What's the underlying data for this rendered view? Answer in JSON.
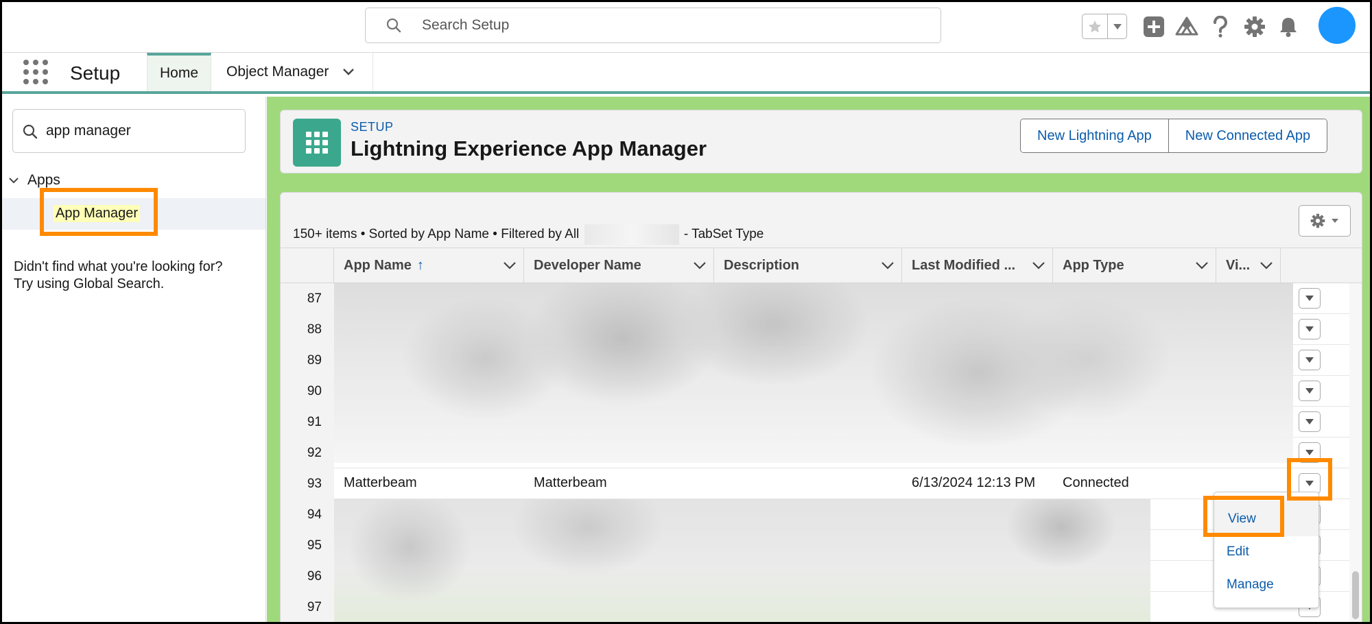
{
  "header": {
    "search_placeholder": "Search Setup"
  },
  "context": {
    "app_name": "Setup",
    "tabs": [
      {
        "label": "Home"
      },
      {
        "label": "Object Manager"
      }
    ]
  },
  "sidebar": {
    "quick_find_value": "app manager",
    "group_label": "Apps",
    "item_label": "App Manager",
    "help_line1": "Didn't find what you're looking for?",
    "help_line2": "Try using Global Search."
  },
  "page_header": {
    "eyebrow": "SETUP",
    "title": "Lightning Experience App Manager",
    "btn_new_lightning": "New Lightning App",
    "btn_new_connected": "New Connected App"
  },
  "list": {
    "info_prefix": "150+ items • Sorted by App Name • Filtered by All",
    "info_suffix": "- TabSet Type",
    "columns": [
      {
        "label": "App Name",
        "sort": "↑"
      },
      {
        "label": "Developer Name"
      },
      {
        "label": "Description"
      },
      {
        "label": "Last Modified ..."
      },
      {
        "label": "App Type"
      },
      {
        "label": "Vi..."
      }
    ],
    "row_numbers": [
      "87",
      "88",
      "89",
      "90",
      "91",
      "92",
      "93",
      "94",
      "95",
      "96",
      "97"
    ],
    "visible_row": {
      "number": "93",
      "app_name": "Matterbeam",
      "developer_name": "Matterbeam",
      "description": "",
      "last_modified": "6/13/2024 12:13 PM",
      "app_type": "Connected"
    }
  },
  "row_menu": {
    "items": [
      "View",
      "Edit",
      "Manage"
    ]
  },
  "colors": {
    "brand_teal": "#58a59a",
    "link_blue": "#0b5cab",
    "annotation_orange": "#ff8a00",
    "page_bg_green": "#9fd97c",
    "avatar_blue": "#1b96ff"
  }
}
